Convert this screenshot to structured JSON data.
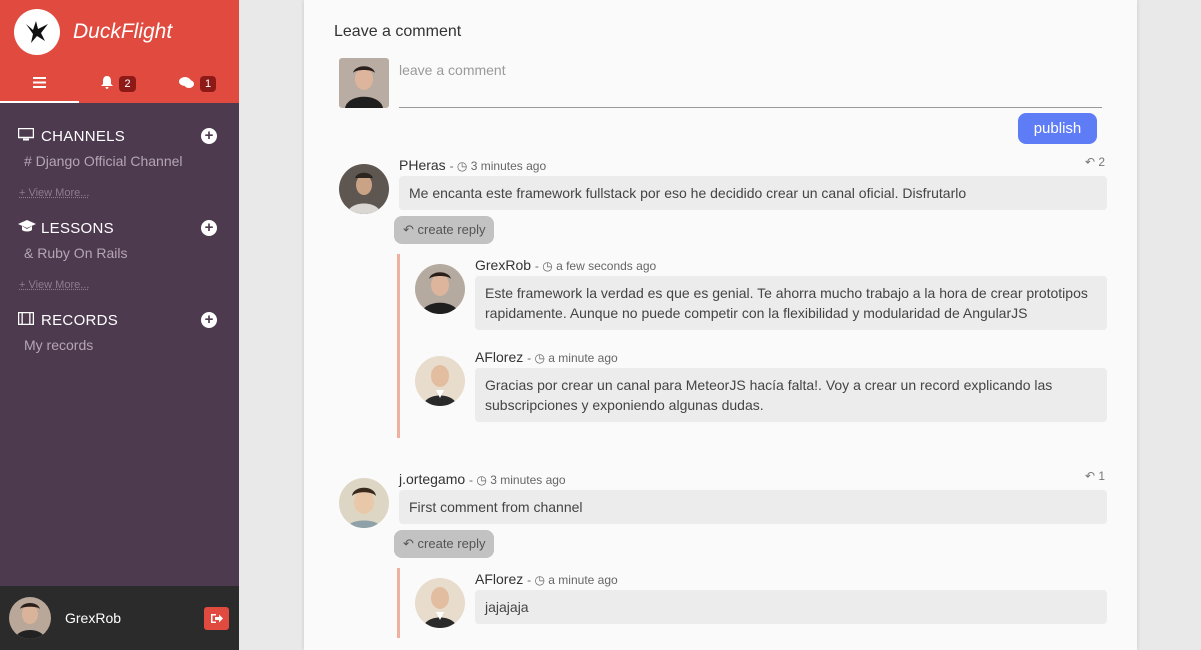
{
  "app": {
    "name": "DuckFlight"
  },
  "tabs": [
    {
      "icon": "menu-icon"
    },
    {
      "icon": "bell-icon",
      "badge": "2"
    },
    {
      "icon": "chat-icon",
      "badge": "1"
    }
  ],
  "sidebar": {
    "channels": {
      "title": "CHANNELS",
      "item": "# Django Official Channel",
      "view_more": "+ View More..."
    },
    "lessons": {
      "title": "LESSONS",
      "item": "& Ruby On Rails",
      "view_more": "+ View More..."
    },
    "records": {
      "title": "RECORDS",
      "item": "My records"
    }
  },
  "user": {
    "name": "GrexRob"
  },
  "comments_form": {
    "title": "Leave a comment",
    "placeholder": "leave a comment",
    "publish_label": "publish"
  },
  "comments": [
    {
      "author": "PHeras",
      "time": "3 minutes ago",
      "text": "Me encanta este framework fullstack por eso he decidido crear un canal oficial. Disfrutarlo",
      "reply_count": "2",
      "reply_label": "create reply",
      "replies": [
        {
          "author": "GrexRob",
          "time": "a few seconds ago",
          "text": "Este framework la verdad es que es genial. Te ahorra mucho trabajo a la hora de crear prototipos rapidamente. Aunque no puede competir con la flexibilidad y modularidad de AngularJS"
        },
        {
          "author": "AFlorez",
          "time": "a minute ago",
          "text": "Gracias por crear un canal para MeteorJS hacía falta!. Voy a crear un record explicando las subscripciones y exponiendo algunas dudas."
        }
      ]
    },
    {
      "author": "j.ortegamo",
      "time": "3 minutes ago",
      "text": "First comment from channel",
      "reply_count": "1",
      "reply_label": "create reply",
      "replies": [
        {
          "author": "AFlorez",
          "time": "a minute ago",
          "text": "jajajaja"
        }
      ]
    }
  ],
  "colors": {
    "brand": "#e04a3f",
    "sidebar": "#4d3a4f",
    "publish": "#5f7cf7",
    "thread": "#f0b0a0"
  }
}
